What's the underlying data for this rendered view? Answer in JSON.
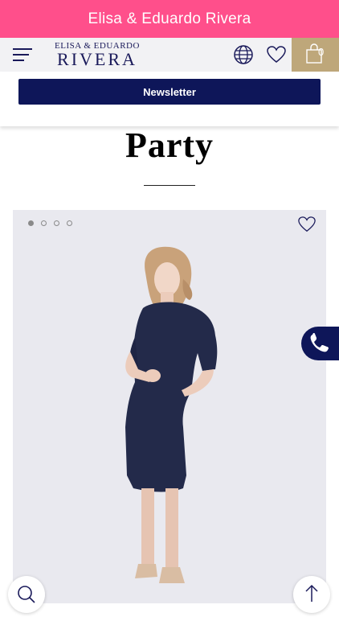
{
  "top_banner": {
    "title": "Elisa & Eduardo Rivera"
  },
  "header": {
    "logo_top": "ELISA & EDUARDO",
    "logo_main": "RIVERA",
    "cart_count": "0"
  },
  "newsletter": {
    "label": "Newsletter"
  },
  "page": {
    "title": "Party"
  },
  "carousel": {
    "total_slides": 4,
    "active_slide": 1
  },
  "colors": {
    "banner": "#ff4f8b",
    "navy": "#0e1659",
    "gold": "#bea77a",
    "header_bg": "#f2f2f4",
    "card_bg": "#e9e9ef"
  },
  "icons": [
    "menu-icon",
    "globe-icon",
    "heart-icon",
    "shopping-bag-icon",
    "phone-icon",
    "search-icon",
    "arrow-up-icon"
  ]
}
